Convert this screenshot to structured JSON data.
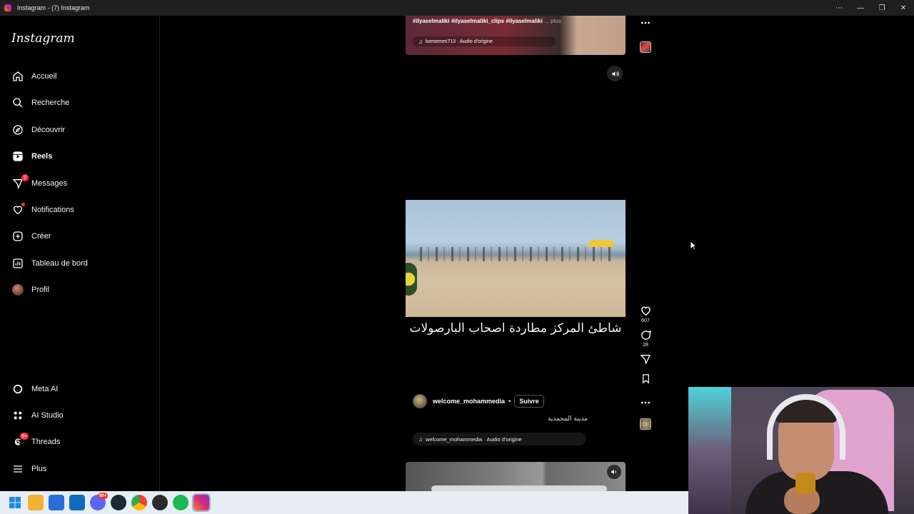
{
  "window": {
    "title": "Instagram - (7) Instagram",
    "controls": [
      "more-options",
      "minimize",
      "restore",
      "close"
    ]
  },
  "sidebar": {
    "logo": "Instagram",
    "items": [
      {
        "label": "Accueil",
        "icon": "home-icon"
      },
      {
        "label": "Recherche",
        "icon": "search-icon"
      },
      {
        "label": "Découvrir",
        "icon": "compass-icon"
      },
      {
        "label": "Reels",
        "icon": "reels-icon",
        "active": true
      },
      {
        "label": "Messages",
        "icon": "messenger-icon",
        "badge": "7"
      },
      {
        "label": "Notifications",
        "icon": "heart-icon",
        "dot": true
      },
      {
        "label": "Créer",
        "icon": "plus-square-icon"
      },
      {
        "label": "Tableau de bord",
        "icon": "bar-chart-icon"
      },
      {
        "label": "Profil",
        "icon": "avatar"
      }
    ],
    "bottom_items": [
      {
        "label": "Meta AI",
        "icon": "meta-ai-icon"
      },
      {
        "label": "AI Studio",
        "icon": "ai-studio-icon"
      },
      {
        "label": "Threads",
        "icon": "threads-icon",
        "badge": "9+"
      },
      {
        "label": "Plus",
        "icon": "menu-icon"
      }
    ]
  },
  "reel_top": {
    "hashtags": "#ilyaselmaliki #ilyaselmaliki_clips #ilyaselmaliki",
    "more": "... plus",
    "audio": "komemes713 · Audio d'origine"
  },
  "reel_main": {
    "caption": "شاطئ المركز مطاردة اصحاب البارصولات",
    "username": "welcome_mohammedia",
    "separator": "•",
    "follow_label": "Suivre",
    "location": "مدينة المحمدية",
    "audio": "welcome_mohammedia · Audio d'origine",
    "likes": "607",
    "comments": "28"
  },
  "taskbar": {
    "apps": [
      {
        "name": "windows-start-icon",
        "color": "#1e88e5"
      },
      {
        "name": "file-explorer-icon",
        "color": "#f2b233"
      },
      {
        "name": "microsoft-store-icon",
        "color": "#2b6cd6"
      },
      {
        "name": "outlook-icon",
        "color": "#0f6cbd"
      },
      {
        "name": "discord-icon",
        "color": "#5865f2",
        "badge": "99+"
      },
      {
        "name": "steam-icon",
        "color": "#1b2838"
      },
      {
        "name": "chrome-icon",
        "color": "#34a853"
      },
      {
        "name": "obs-icon",
        "color": "#2b2b2b"
      },
      {
        "name": "spotify-icon",
        "color": "#1db954"
      },
      {
        "name": "instagram-icon",
        "color": "#d6249f"
      }
    ]
  }
}
